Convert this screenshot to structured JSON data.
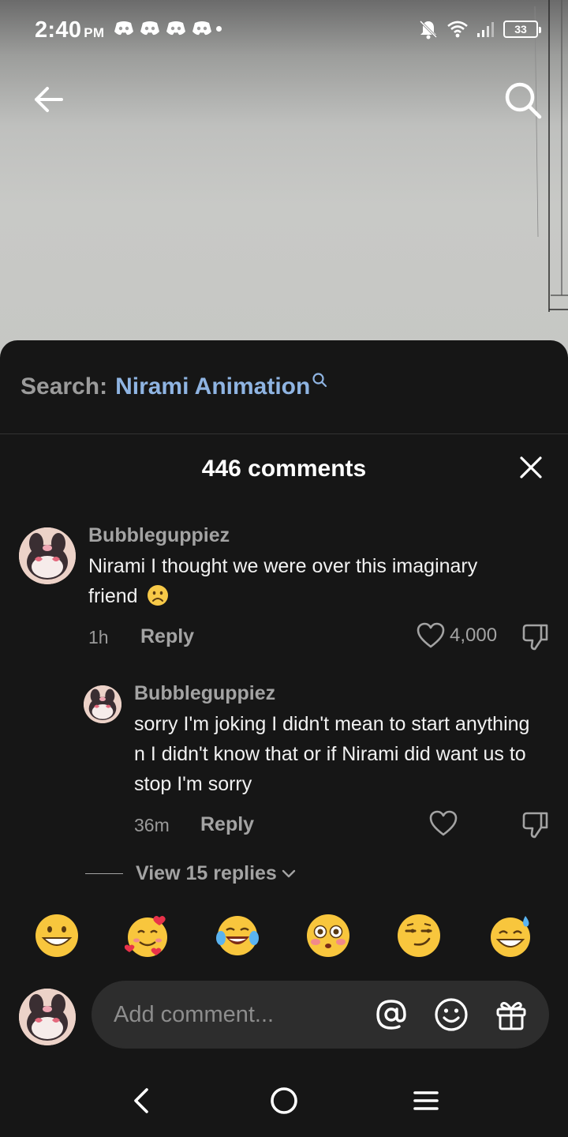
{
  "status_bar": {
    "time": "2:40",
    "ampm": "PM",
    "battery": "33",
    "icons": [
      "discord-icon",
      "discord-icon",
      "discord-icon",
      "discord-icon",
      "dot-icon",
      "mute-bell-icon",
      "wifi-icon",
      "signal-icon",
      "battery-icon"
    ]
  },
  "top": {
    "back_icon": "arrow-left-icon",
    "search_icon": "search-icon"
  },
  "sheet": {
    "search_prefix": "Search:",
    "search_term": "Nirami Animation",
    "comments_count": "446 comments",
    "close_icon": "close-icon"
  },
  "comments": [
    {
      "username": "Bubbleguppiez",
      "text": "Nirami I thought we were over this imaginary friend",
      "emoji": "frowning-face",
      "time": "1h",
      "reply_label": "Reply",
      "likes": "4,000"
    },
    {
      "username": "Bubbleguppiez",
      "text": "sorry I'm joking I didn't mean to start anything n I didn't know that or if Nirami did want us to stop I'm sorry",
      "time": "36m",
      "reply_label": "Reply",
      "likes": ""
    }
  ],
  "view_replies": "View 15 replies",
  "emoji_row": [
    "grinning-face",
    "smiling-face-with-hearts",
    "face-with-tears-of-joy",
    "flushed-face",
    "smirking-face",
    "grinning-face-with-sweat"
  ],
  "composer": {
    "placeholder": "Add comment...",
    "icons": [
      "at-icon",
      "emoji-icon",
      "gift-icon"
    ]
  },
  "navbar": {
    "icons": [
      "nav-back-icon",
      "nav-home-icon",
      "nav-menu-icon"
    ]
  },
  "colors": {
    "sheet_bg": "#161616",
    "accent_link": "#8fb4e2",
    "muted_text": "#a3a3a3",
    "input_bg": "#2d2d2d"
  }
}
